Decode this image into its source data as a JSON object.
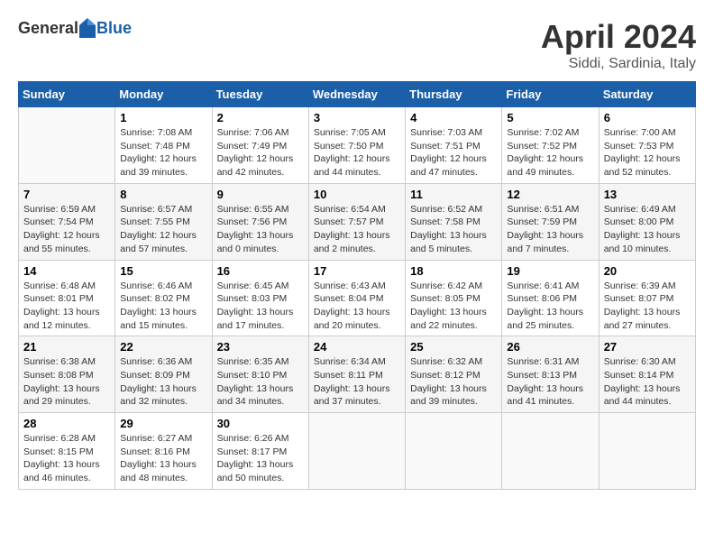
{
  "header": {
    "logo_general": "General",
    "logo_blue": "Blue",
    "month": "April 2024",
    "location": "Siddi, Sardinia, Italy"
  },
  "weekdays": [
    "Sunday",
    "Monday",
    "Tuesday",
    "Wednesday",
    "Thursday",
    "Friday",
    "Saturday"
  ],
  "weeks": [
    [
      {
        "day": "",
        "info": ""
      },
      {
        "day": "1",
        "info": "Sunrise: 7:08 AM\nSunset: 7:48 PM\nDaylight: 12 hours\nand 39 minutes."
      },
      {
        "day": "2",
        "info": "Sunrise: 7:06 AM\nSunset: 7:49 PM\nDaylight: 12 hours\nand 42 minutes."
      },
      {
        "day": "3",
        "info": "Sunrise: 7:05 AM\nSunset: 7:50 PM\nDaylight: 12 hours\nand 44 minutes."
      },
      {
        "day": "4",
        "info": "Sunrise: 7:03 AM\nSunset: 7:51 PM\nDaylight: 12 hours\nand 47 minutes."
      },
      {
        "day": "5",
        "info": "Sunrise: 7:02 AM\nSunset: 7:52 PM\nDaylight: 12 hours\nand 49 minutes."
      },
      {
        "day": "6",
        "info": "Sunrise: 7:00 AM\nSunset: 7:53 PM\nDaylight: 12 hours\nand 52 minutes."
      }
    ],
    [
      {
        "day": "7",
        "info": "Sunrise: 6:59 AM\nSunset: 7:54 PM\nDaylight: 12 hours\nand 55 minutes."
      },
      {
        "day": "8",
        "info": "Sunrise: 6:57 AM\nSunset: 7:55 PM\nDaylight: 12 hours\nand 57 minutes."
      },
      {
        "day": "9",
        "info": "Sunrise: 6:55 AM\nSunset: 7:56 PM\nDaylight: 13 hours\nand 0 minutes."
      },
      {
        "day": "10",
        "info": "Sunrise: 6:54 AM\nSunset: 7:57 PM\nDaylight: 13 hours\nand 2 minutes."
      },
      {
        "day": "11",
        "info": "Sunrise: 6:52 AM\nSunset: 7:58 PM\nDaylight: 13 hours\nand 5 minutes."
      },
      {
        "day": "12",
        "info": "Sunrise: 6:51 AM\nSunset: 7:59 PM\nDaylight: 13 hours\nand 7 minutes."
      },
      {
        "day": "13",
        "info": "Sunrise: 6:49 AM\nSunset: 8:00 PM\nDaylight: 13 hours\nand 10 minutes."
      }
    ],
    [
      {
        "day": "14",
        "info": "Sunrise: 6:48 AM\nSunset: 8:01 PM\nDaylight: 13 hours\nand 12 minutes."
      },
      {
        "day": "15",
        "info": "Sunrise: 6:46 AM\nSunset: 8:02 PM\nDaylight: 13 hours\nand 15 minutes."
      },
      {
        "day": "16",
        "info": "Sunrise: 6:45 AM\nSunset: 8:03 PM\nDaylight: 13 hours\nand 17 minutes."
      },
      {
        "day": "17",
        "info": "Sunrise: 6:43 AM\nSunset: 8:04 PM\nDaylight: 13 hours\nand 20 minutes."
      },
      {
        "day": "18",
        "info": "Sunrise: 6:42 AM\nSunset: 8:05 PM\nDaylight: 13 hours\nand 22 minutes."
      },
      {
        "day": "19",
        "info": "Sunrise: 6:41 AM\nSunset: 8:06 PM\nDaylight: 13 hours\nand 25 minutes."
      },
      {
        "day": "20",
        "info": "Sunrise: 6:39 AM\nSunset: 8:07 PM\nDaylight: 13 hours\nand 27 minutes."
      }
    ],
    [
      {
        "day": "21",
        "info": "Sunrise: 6:38 AM\nSunset: 8:08 PM\nDaylight: 13 hours\nand 29 minutes."
      },
      {
        "day": "22",
        "info": "Sunrise: 6:36 AM\nSunset: 8:09 PM\nDaylight: 13 hours\nand 32 minutes."
      },
      {
        "day": "23",
        "info": "Sunrise: 6:35 AM\nSunset: 8:10 PM\nDaylight: 13 hours\nand 34 minutes."
      },
      {
        "day": "24",
        "info": "Sunrise: 6:34 AM\nSunset: 8:11 PM\nDaylight: 13 hours\nand 37 minutes."
      },
      {
        "day": "25",
        "info": "Sunrise: 6:32 AM\nSunset: 8:12 PM\nDaylight: 13 hours\nand 39 minutes."
      },
      {
        "day": "26",
        "info": "Sunrise: 6:31 AM\nSunset: 8:13 PM\nDaylight: 13 hours\nand 41 minutes."
      },
      {
        "day": "27",
        "info": "Sunrise: 6:30 AM\nSunset: 8:14 PM\nDaylight: 13 hours\nand 44 minutes."
      }
    ],
    [
      {
        "day": "28",
        "info": "Sunrise: 6:28 AM\nSunset: 8:15 PM\nDaylight: 13 hours\nand 46 minutes."
      },
      {
        "day": "29",
        "info": "Sunrise: 6:27 AM\nSunset: 8:16 PM\nDaylight: 13 hours\nand 48 minutes."
      },
      {
        "day": "30",
        "info": "Sunrise: 6:26 AM\nSunset: 8:17 PM\nDaylight: 13 hours\nand 50 minutes."
      },
      {
        "day": "",
        "info": ""
      },
      {
        "day": "",
        "info": ""
      },
      {
        "day": "",
        "info": ""
      },
      {
        "day": "",
        "info": ""
      }
    ]
  ]
}
